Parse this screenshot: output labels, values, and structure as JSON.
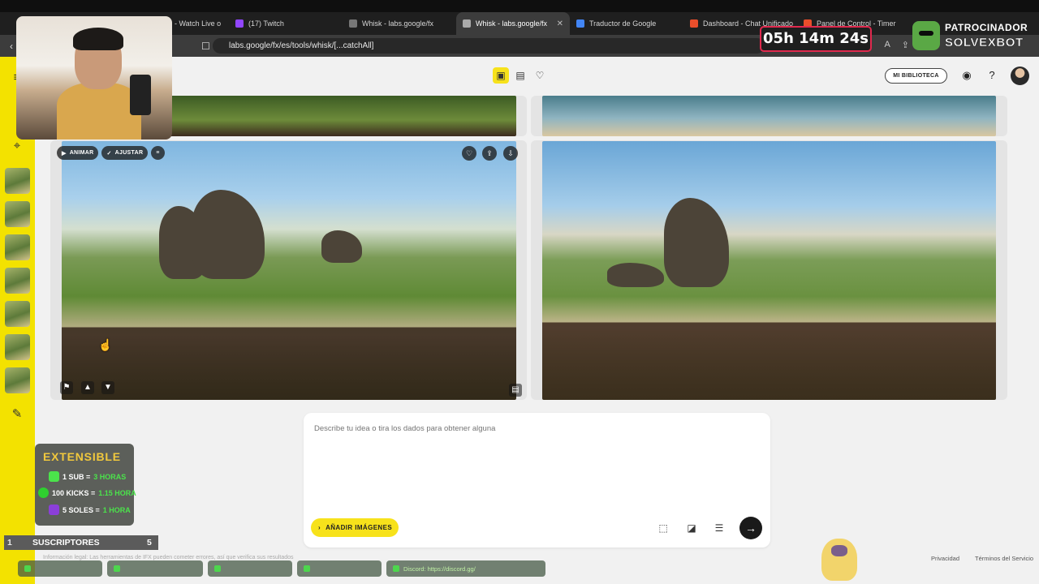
{
  "browser": {
    "tabs": [
      {
        "title": "am - Watch Live o",
        "active": false,
        "color": "#000000"
      },
      {
        "title": "(17) Twitch",
        "active": false,
        "color": "#9146ff"
      },
      {
        "title": "Whisk - labs.google/fx",
        "active": false,
        "color": "#888888"
      },
      {
        "title": "Whisk - labs.google/fx",
        "active": true,
        "color": "#888888"
      },
      {
        "title": "Traductor de Google",
        "active": false,
        "color": "#4285f4"
      },
      {
        "title": "Dashboard - Chat Unificado",
        "active": false,
        "color": "#e94e2b"
      },
      {
        "title": "Panel de Control - Timer",
        "active": false,
        "color": "#e94e2b"
      }
    ],
    "url": "labs.google/fx/es/tools/whisk/[...catchAll]"
  },
  "header": {
    "library_label": "MI BIBLIOTECA",
    "accent_color": "#f7e21b"
  },
  "gallery": {
    "chip_animate": "ANIMAR",
    "chip_adjust": "AJUSTAR"
  },
  "prompt": {
    "placeholder": "Describe tu idea o tira los dados para obtener alguna",
    "add_images_label": "AÑADIR IMÁGENES"
  },
  "footer": {
    "legal": "Información legal: Las herramientas de IFX pueden cometer errores, así que verifica sus resultados",
    "privacy": "Privacidad",
    "terms": "Términos del Servicio"
  },
  "overlay": {
    "timer": "05h 14m 24s",
    "sponsor_line1": "PATROCINADOR",
    "sponsor_line2": "SOLVEXBOT",
    "extensible_title": "EXTENSIBLE",
    "ext_line1_a": "1 SUB = ",
    "ext_line1_b": "3 HORAS",
    "ext_line2_a": "100 KICKS = ",
    "ext_line2_b": "1.15 HORA",
    "ext_line3_a": "5 SOLES = ",
    "ext_line3_b": "1 HORA",
    "subs_left": "1",
    "subs_label": "SUSCRIPTORES",
    "subs_right": "5",
    "discord_alert": "Discord: https://discord.gg/"
  }
}
